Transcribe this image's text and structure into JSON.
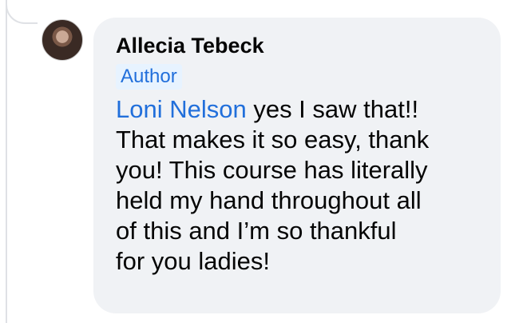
{
  "comment": {
    "author": "Allecia Tebeck",
    "badge": "Author",
    "mention": "Loni Nelson",
    "text": " yes I saw that!!\nThat makes it so easy, thank\nyou! This course has literally\nheld my hand throughout all\nof this and I’m so thankful\nfor you ladies!"
  },
  "colors": {
    "bubble": "#f0f2f5",
    "mention": "#216fdb",
    "badge_bg": "#e7f3ff"
  }
}
